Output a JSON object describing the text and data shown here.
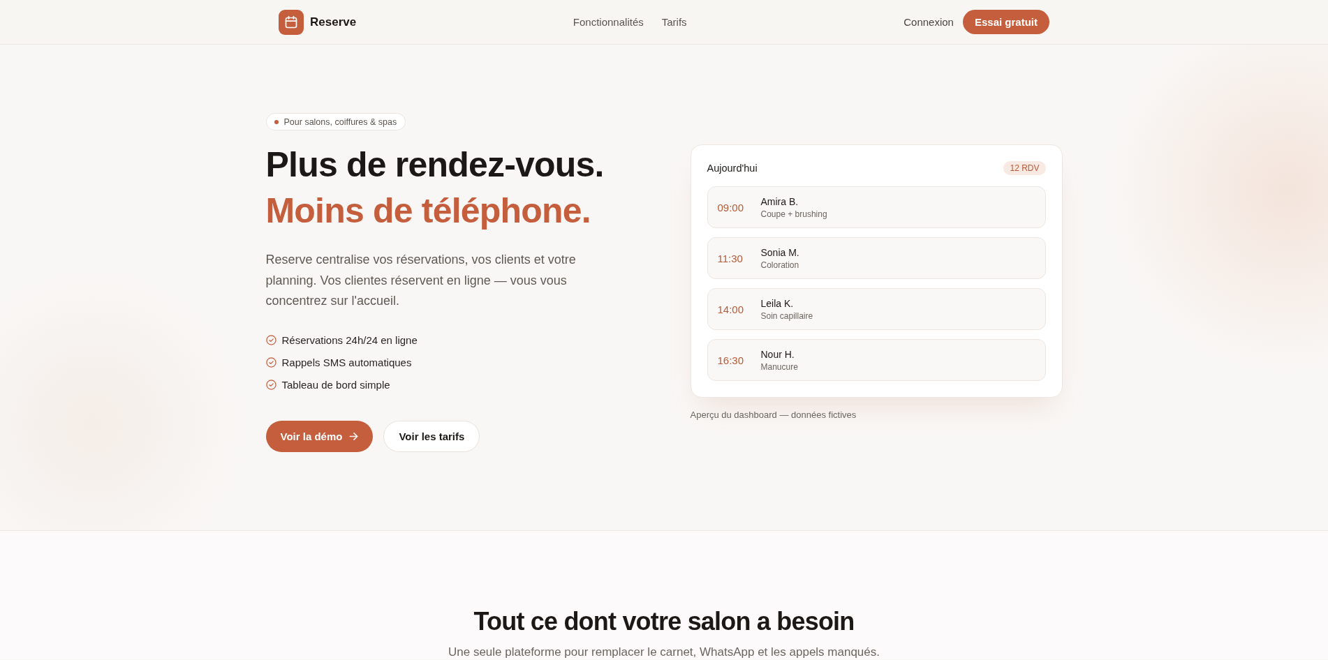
{
  "header": {
    "brand": "Reserve",
    "nav": [
      "Fonctionnalités",
      "Tarifs"
    ],
    "login": "Connexion",
    "cta": "Essai gratuit"
  },
  "hero": {
    "badge": "Pour salons, coiffures & spas",
    "title_lines": [
      {
        "text": "Plus de rendez-vous.",
        "accent": false
      },
      {
        "text": "Moins de téléphone.",
        "accent": true
      }
    ],
    "description": "Reserve centralise vos réservations, vos clients et votre planning. Vos clientes réservent en ligne — vous vous concentrez sur l'accueil.",
    "features": [
      "Réservations 24h/24 en ligne",
      "Rappels SMS automatiques",
      "Tableau de bord simple"
    ],
    "buttons": [
      {
        "label": "Voir la démo",
        "kind": "primary"
      },
      {
        "label": "Voir les tarifs",
        "kind": "secondary"
      }
    ]
  },
  "preview": {
    "title": "Aujourd'hui",
    "count": "12 RDV",
    "appointments": [
      {
        "time": "09:00",
        "name": "Amira B.",
        "service": "Coupe + brushing"
      },
      {
        "time": "11:30",
        "name": "Sonia M.",
        "service": "Coloration"
      },
      {
        "time": "14:00",
        "name": "Leila K.",
        "service": "Soin capillaire"
      },
      {
        "time": "16:30",
        "name": "Nour H.",
        "service": "Manucure"
      }
    ],
    "caption": "Aperçu du dashboard — données fictives"
  },
  "features_section": {
    "title": "Tout ce dont votre salon a besoin",
    "subtitle": "Une seule plateforme pour remplacer le carnet, WhatsApp et les appels manqués."
  }
}
